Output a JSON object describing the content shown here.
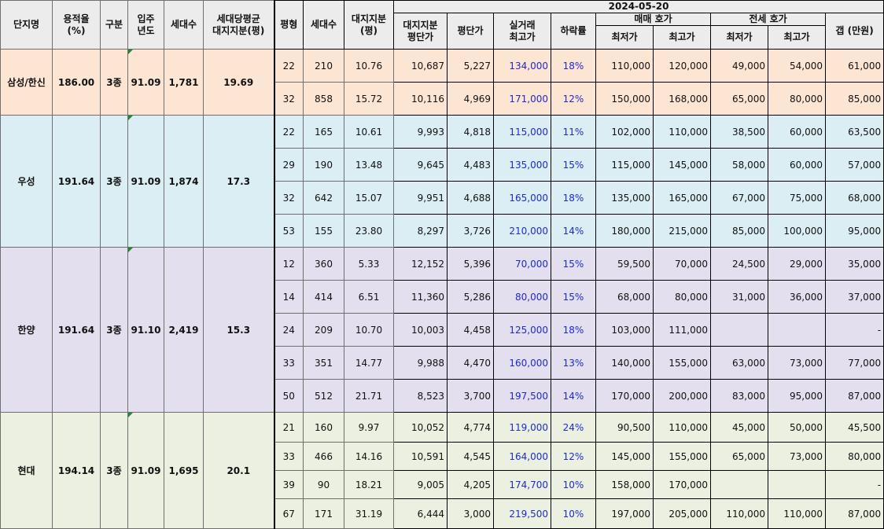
{
  "date": "2024-05-20",
  "headers": {
    "complex": "단지명",
    "far": "용적율",
    "far_unit": "(%)",
    "zone": "구분",
    "move_in_1": "입주",
    "move_in_2": "년도",
    "households": "세대수",
    "avg_land_1": "세대당평균",
    "avg_land_2": "대지지분(평)",
    "pyeong": "평형",
    "unit_households": "세대수",
    "land_share_1": "대지지분",
    "land_share_2": "(평)",
    "land_price_1": "대지지분",
    "land_price_2": "평단가",
    "per_pyeong": "평단가",
    "deal_max_1": "실거래",
    "deal_max_2": "최고가",
    "drop_rate": "하락률",
    "sale_group": "매매 호가",
    "jeonse_group": "전세 호가",
    "min": "최저가",
    "max": "최고가",
    "gap": "갭 (만원)"
  },
  "complexes": [
    {
      "name": "삼성/한신",
      "far": "186.00",
      "zone": "3종",
      "year": "91.09",
      "households": "1,781",
      "avg_land": "19.69",
      "bg": "#fde5d4",
      "rows": [
        {
          "py": "22",
          "hh": "210",
          "land": "10.76",
          "land_price": "10,687",
          "ppy": "5,227",
          "deal_max": "134,000",
          "drop": "18%",
          "sale_min": "110,000",
          "sale_max": "120,000",
          "jeon_min": "49,000",
          "jeon_max": "54,000",
          "gap": "61,000"
        },
        {
          "py": "32",
          "hh": "858",
          "land": "15.72",
          "land_price": "10,116",
          "ppy": "4,969",
          "deal_max": "171,000",
          "drop": "12%",
          "sale_min": "150,000",
          "sale_max": "168,000",
          "jeon_min": "65,000",
          "jeon_max": "80,000",
          "gap": "85,000"
        }
      ]
    },
    {
      "name": "우성",
      "far": "191.64",
      "zone": "3종",
      "year": "91.09",
      "households": "1,874",
      "avg_land": "17.3",
      "bg": "#dbeef4",
      "rows": [
        {
          "py": "22",
          "hh": "165",
          "land": "10.61",
          "land_price": "9,993",
          "ppy": "4,818",
          "deal_max": "115,000",
          "drop": "11%",
          "sale_min": "102,000",
          "sale_max": "110,000",
          "jeon_min": "38,500",
          "jeon_max": "60,000",
          "gap": "63,500"
        },
        {
          "py": "29",
          "hh": "190",
          "land": "13.48",
          "land_price": "9,645",
          "ppy": "4,483",
          "deal_max": "135,000",
          "drop": "15%",
          "sale_min": "115,000",
          "sale_max": "145,000",
          "jeon_min": "58,000",
          "jeon_max": "60,000",
          "gap": "57,000"
        },
        {
          "py": "32",
          "hh": "642",
          "land": "15.07",
          "land_price": "9,951",
          "ppy": "4,688",
          "deal_max": "165,000",
          "drop": "18%",
          "sale_min": "135,000",
          "sale_max": "165,000",
          "jeon_min": "67,000",
          "jeon_max": "75,000",
          "gap": "68,000"
        },
        {
          "py": "53",
          "hh": "155",
          "land": "23.80",
          "land_price": "8,297",
          "ppy": "3,726",
          "deal_max": "210,000",
          "drop": "14%",
          "sale_min": "180,000",
          "sale_max": "215,000",
          "jeon_min": "85,000",
          "jeon_max": "100,000",
          "gap": "95,000"
        }
      ]
    },
    {
      "name": "한양",
      "far": "191.64",
      "zone": "3종",
      "year": "91.10",
      "households": "2,419",
      "avg_land": "15.3",
      "bg": "#e4dfee",
      "rows": [
        {
          "py": "12",
          "hh": "360",
          "land": "5.33",
          "land_price": "12,152",
          "ppy": "5,396",
          "deal_max": "70,000",
          "drop": "15%",
          "sale_min": "59,500",
          "sale_max": "70,000",
          "jeon_min": "24,500",
          "jeon_max": "29,000",
          "gap": "35,000"
        },
        {
          "py": "14",
          "hh": "414",
          "land": "6.51",
          "land_price": "11,360",
          "ppy": "5,286",
          "deal_max": "80,000",
          "drop": "15%",
          "sale_min": "68,000",
          "sale_max": "80,000",
          "jeon_min": "31,000",
          "jeon_max": "36,000",
          "gap": "37,000"
        },
        {
          "py": "24",
          "hh": "209",
          "land": "10.70",
          "land_price": "10,003",
          "ppy": "4,458",
          "deal_max": "125,000",
          "drop": "18%",
          "sale_min": "103,000",
          "sale_max": "111,000",
          "jeon_min": "",
          "jeon_max": "",
          "gap": "-"
        },
        {
          "py": "33",
          "hh": "351",
          "land": "14.77",
          "land_price": "9,988",
          "ppy": "4,470",
          "deal_max": "160,000",
          "drop": "13%",
          "sale_min": "140,000",
          "sale_max": "155,000",
          "jeon_min": "63,000",
          "jeon_max": "73,000",
          "gap": "77,000"
        },
        {
          "py": "50",
          "hh": "512",
          "land": "21.71",
          "land_price": "8,523",
          "ppy": "3,700",
          "deal_max": "197,500",
          "drop": "14%",
          "sale_min": "170,000",
          "sale_max": "200,000",
          "jeon_min": "83,000",
          "jeon_max": "95,000",
          "gap": "87,000"
        }
      ]
    },
    {
      "name": "현대",
      "far": "194.14",
      "zone": "3종",
      "year": "91.09",
      "households": "1,695",
      "avg_land": "20.1",
      "bg": "#ebf0e0",
      "rows": [
        {
          "py": "21",
          "hh": "160",
          "land": "9.97",
          "land_price": "10,052",
          "ppy": "4,774",
          "deal_max": "119,000",
          "drop": "24%",
          "sale_min": "90,500",
          "sale_max": "110,000",
          "jeon_min": "45,000",
          "jeon_max": "50,000",
          "gap": "45,500"
        },
        {
          "py": "33",
          "hh": "466",
          "land": "14.16",
          "land_price": "10,591",
          "ppy": "4,545",
          "deal_max": "164,000",
          "drop": "12%",
          "sale_min": "145,000",
          "sale_max": "155,000",
          "jeon_min": "65,000",
          "jeon_max": "73,000",
          "gap": "80,000"
        },
        {
          "py": "39",
          "hh": "90",
          "land": "18.21",
          "land_price": "9,005",
          "ppy": "4,205",
          "deal_max": "174,700",
          "drop": "10%",
          "sale_min": "158,000",
          "sale_max": "170,000",
          "jeon_min": "",
          "jeon_max": "",
          "gap": "-"
        },
        {
          "py": "67",
          "hh": "171",
          "land": "31.19",
          "land_price": "6,444",
          "ppy": "3,000",
          "deal_max": "219,500",
          "drop": "10%",
          "sale_min": "197,000",
          "sale_max": "205,000",
          "jeon_min": "110,000",
          "jeon_max": "110,000",
          "gap": "87,000"
        }
      ]
    }
  ]
}
